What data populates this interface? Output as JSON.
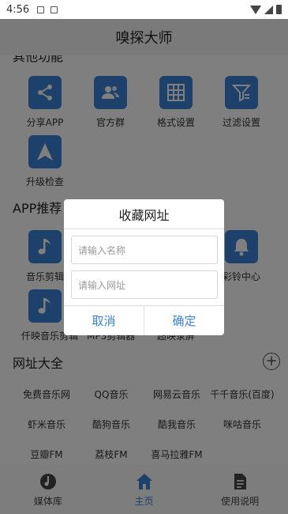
{
  "status": {
    "time": "4:56"
  },
  "app": {
    "title": "嗅探大师"
  },
  "sections": {
    "other_title": "其他功能",
    "app_title": "APP推荐",
    "links_title": "网址大全"
  },
  "other_tiles": [
    {
      "label": "分享APP",
      "icon": "share-icon"
    },
    {
      "label": "官方群",
      "icon": "group-icon"
    },
    {
      "label": "格式设置",
      "icon": "grid-icon"
    },
    {
      "label": "过滤设置",
      "icon": "filter-icon"
    },
    {
      "label": "升级检查",
      "icon": "arrow-up-icon"
    }
  ],
  "app_tiles": [
    {
      "label": "音乐剪辑",
      "icon": "music-note-icon"
    },
    {
      "label": "彩铃中心",
      "icon": "bell-icon"
    },
    {
      "label": "仟映音乐剪辑",
      "icon": "music-note-icon"
    },
    {
      "label": "MP3剪辑器",
      "icon": "music-note-icon"
    },
    {
      "label": "超映录屏",
      "icon": "screen-record-icon"
    }
  ],
  "links": [
    "免费音乐网",
    "QQ音乐",
    "网易云音乐",
    "千千音乐(百度)",
    "虾米音乐",
    "酷狗音乐",
    "酷我音乐",
    "咪咕音乐",
    "豆瓣FM",
    "荔枝FM",
    "喜马拉雅FM"
  ],
  "nav": [
    {
      "label": "媒体库",
      "icon": "media-library-icon"
    },
    {
      "label": "主页",
      "icon": "home-icon",
      "active": true
    },
    {
      "label": "使用说明",
      "icon": "document-icon"
    }
  ],
  "dialog": {
    "title": "收藏网址",
    "name_placeholder": "请输入名称",
    "url_placeholder": "请输入网址",
    "cancel": "取消",
    "confirm": "确定"
  },
  "colors": {
    "accent": "#3b82d4",
    "overlay": "rgba(0,0,0,0.5)"
  }
}
